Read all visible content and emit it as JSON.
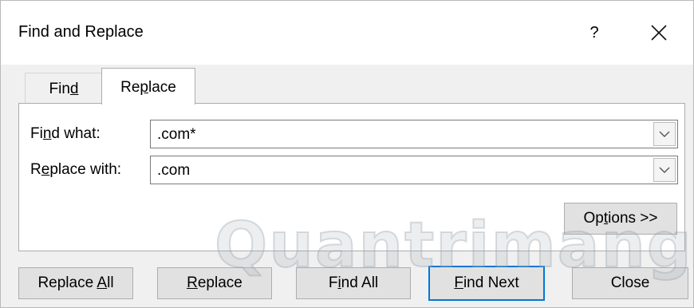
{
  "window": {
    "title": "Find and Replace",
    "help_label": "?"
  },
  "tabs": [
    {
      "pre": "Fin",
      "key": "d",
      "post": "",
      "active": false
    },
    {
      "pre": "Re",
      "key": "p",
      "post": "lace",
      "active": true
    }
  ],
  "fields": {
    "find": {
      "label_pre": "Fi",
      "label_key": "n",
      "label_post": "d what:",
      "value": ".com*"
    },
    "replace": {
      "label_pre": "R",
      "label_key": "e",
      "label_post": "place with:",
      "value": ".com"
    }
  },
  "options_button": {
    "pre": "Op",
    "key": "t",
    "post": "ions >>"
  },
  "buttons": {
    "replace_all": {
      "pre": "Replace ",
      "key": "A",
      "post": "ll"
    },
    "replace": {
      "pre": "",
      "key": "R",
      "post": "eplace"
    },
    "find_all": {
      "pre": "F",
      "key": "i",
      "post": "nd All"
    },
    "find_next": {
      "pre": "",
      "key": "F",
      "post": "ind Next"
    },
    "close": {
      "label": "Close"
    }
  },
  "watermark": "Quantrimang",
  "colors": {
    "accent": "#0078d7",
    "dialog_bg": "#f0f0f0",
    "button_bg": "#e1e1e1"
  }
}
